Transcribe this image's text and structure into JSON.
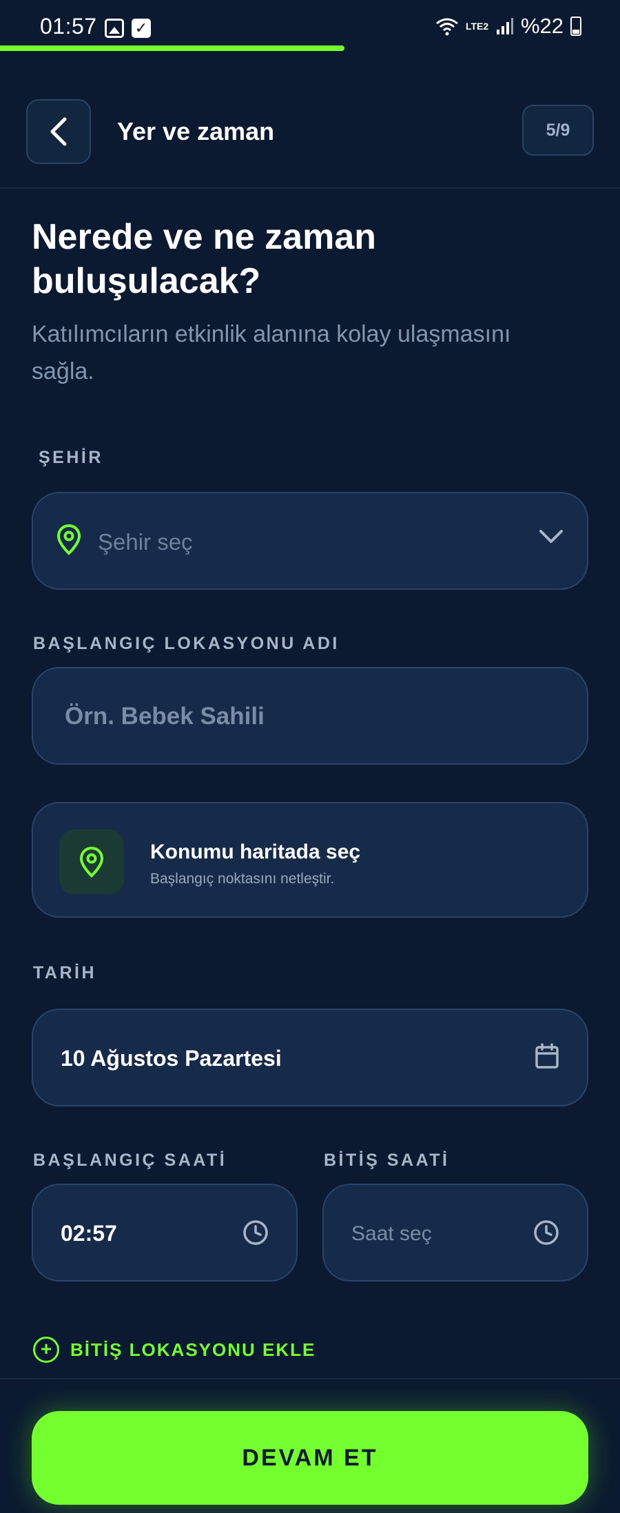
{
  "status_bar": {
    "time": "01:57",
    "battery": "%22",
    "network": "LTE2"
  },
  "progress": {
    "fraction": 0.556
  },
  "header": {
    "title": "Yer ve zaman",
    "step": "5/9"
  },
  "intro": {
    "heading": "Nerede ve ne zaman buluşulacak?",
    "subheading": "Katılımcıların etkinlik alanına kolay ulaşmasını sağla."
  },
  "city": {
    "label": "ŞEHİR",
    "placeholder": "Şehir seç"
  },
  "start_location": {
    "label": "BAŞLANGIÇ LOKASYONU ADI",
    "placeholder": "Örn. Bebek Sahili"
  },
  "map_picker": {
    "title": "Konumu haritada seç",
    "subtitle": "Başlangıç noktasını netleştir."
  },
  "date": {
    "label": "TARİH",
    "value": "10 Ağustos Pazartesi"
  },
  "start_time": {
    "label": "BAŞLANGIÇ SAATİ",
    "value": "02:57"
  },
  "end_time": {
    "label": "BİTİŞ SAATİ",
    "placeholder": "Saat seç"
  },
  "add_end_location": {
    "label": "BİTİŞ LOKASYONU EKLE"
  },
  "continue_button": {
    "label": "DEVAM ET"
  },
  "colors": {
    "background": "#0b1a30",
    "accent": "#74ff2e",
    "field": "#162b4a"
  }
}
